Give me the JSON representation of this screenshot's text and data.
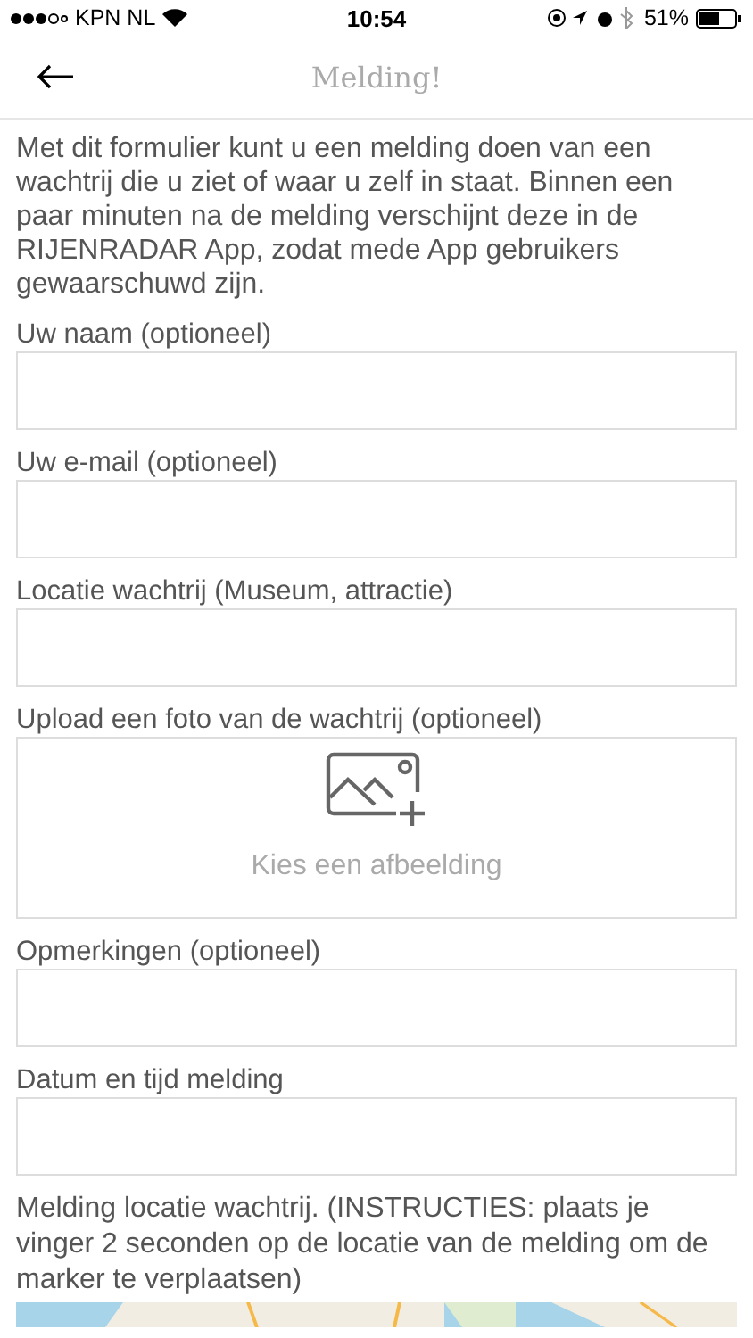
{
  "status_bar": {
    "carrier": "KPN NL",
    "time": "10:54",
    "battery": "51%"
  },
  "nav": {
    "title": "Melding!"
  },
  "intro": "Met dit formulier kunt u een melding doen van een wachtrij die u ziet of waar u zelf in staat. Binnen een paar minuten na de melding verschijnt deze in de RIJENRADAR App, zodat mede App gebruikers gewaarschuwd zijn.",
  "fields": [
    {
      "kind": "text",
      "label": "Uw naam (optioneel)"
    },
    {
      "kind": "text",
      "label": "Uw e-mail (optioneel)"
    },
    {
      "kind": "text",
      "label": "Locatie wachtrij (Museum, attractie)"
    },
    {
      "kind": "upload",
      "label": "Upload een foto van de wachtrij (optioneel)",
      "placeholder": "Kies een afbeelding"
    },
    {
      "kind": "text",
      "label": "Opmerkingen (optioneel)"
    },
    {
      "kind": "text",
      "label": "Datum en tijd melding"
    }
  ],
  "map_section": {
    "label": "Melding locatie wachtrij. (INSTRUCTIES: plaats je vinger 2 seconden op de locatie van de melding om de marker te verplaatsen)"
  }
}
